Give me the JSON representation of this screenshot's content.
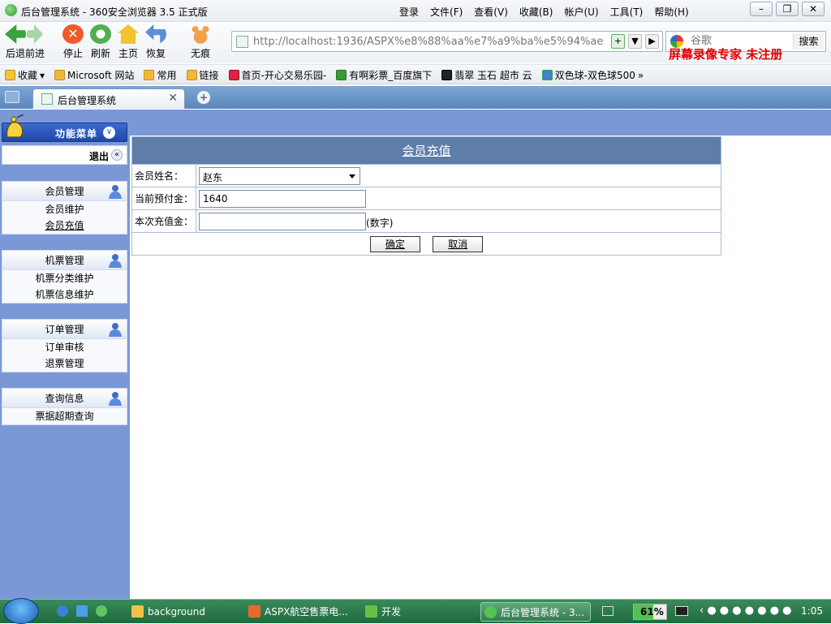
{
  "browser": {
    "title": "后台管理系统 - 360安全浏览器 3.5 正式版",
    "menu": [
      "登录",
      "文件(F)",
      "查看(V)",
      "收藏(B)",
      "帐户(U)",
      "工具(T)",
      "帮助(H)"
    ],
    "toolbar": {
      "back": "后退",
      "forward": "前进",
      "stop": "停止",
      "refresh": "刷新",
      "home": "主页",
      "restore": "恢复",
      "incognito": "无痕"
    },
    "address": "http://localhost:1936/ASPX%e8%88%aa%e7%a9%ba%e5%94%ae",
    "search_placeholder": "谷歌",
    "search_button": "搜索",
    "watermark": "屏幕录像专家  未注册",
    "favorites": [
      "收藏",
      "Microsoft 网站",
      "常用",
      "链接",
      "首页-开心交易乐园-",
      "有啊彩票_百度旗下",
      "翡翠 玉石 超市 云",
      "双色球-双色球500"
    ],
    "tab_title": "后台管理系统"
  },
  "sidebar": {
    "header": "功能菜单",
    "logout": "退出",
    "groups": [
      {
        "title": "会员管理",
        "items": [
          "会员维护",
          "会员充值"
        ]
      },
      {
        "title": "机票管理",
        "items": [
          "机票分类维护",
          "机票信息维护"
        ]
      },
      {
        "title": "订单管理",
        "items": [
          "订单审核",
          "退票管理"
        ]
      },
      {
        "title": "查询信息",
        "items": [
          "票据超期查询"
        ]
      }
    ]
  },
  "form": {
    "title": "会员充值",
    "member_label": "会员姓名：",
    "member_value": "赵东",
    "balance_label": "当前预付金：",
    "balance_value": "1640",
    "recharge_label": "本次充值金：",
    "recharge_value": "",
    "recharge_hint": "(数字)",
    "confirm": "确定",
    "cancel": "取消"
  },
  "taskbar": {
    "items": [
      "background",
      "ASPX航空售票电...",
      "开发",
      "后台管理系统 - 3..."
    ],
    "battery_percent": 61,
    "battery_label": "61%",
    "clock": "1:05"
  }
}
